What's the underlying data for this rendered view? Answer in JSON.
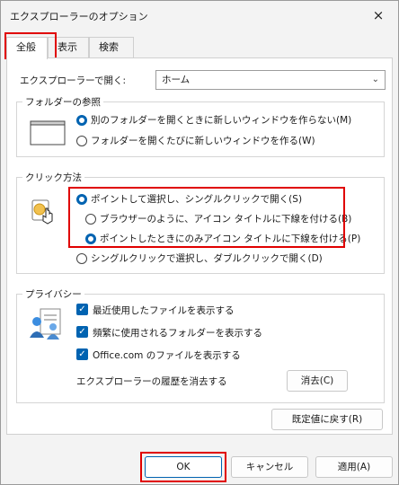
{
  "window": {
    "title": "エクスプローラーのオプション",
    "close_icon": "×"
  },
  "tabs": [
    {
      "label": "全般"
    },
    {
      "label": "表示"
    },
    {
      "label": "検索"
    }
  ],
  "open_explorer": {
    "label": "エクスプローラーで開く:",
    "value": "ホーム"
  },
  "folder_browse": {
    "title": "フォルダーの参照",
    "options": [
      "別のフォルダーを開くときに新しいウィンドウを作らない(M)",
      "フォルダーを開くたびに新しいウィンドウを作る(W)"
    ],
    "selected": 0
  },
  "click_method": {
    "title": "クリック方法",
    "single_click": "ポイントして選択し、シングルクリックで開く(S)",
    "underline_browser": "ブラウザーのように、アイコン タイトルに下線を付ける(B)",
    "underline_point": "ポイントしたときにのみアイコン タイトルに下線を付ける(P)",
    "double_click": "シングルクリックで選択し、ダブルクリックで開く(D)"
  },
  "privacy": {
    "title": "プライバシー",
    "options": [
      "最近使用したファイルを表示する",
      "頻繁に使用されるフォルダーを表示する",
      "Office.com のファイルを表示する"
    ],
    "clear_label": "エクスプローラーの履歴を消去する",
    "clear_button": "消去(C)"
  },
  "restore_button": "既定値に戻す(R)",
  "footer": {
    "ok": "OK",
    "cancel": "キャンセル",
    "apply": "適用(A)"
  },
  "colors": {
    "accent": "#0063b1",
    "highlight": "#e00000"
  }
}
